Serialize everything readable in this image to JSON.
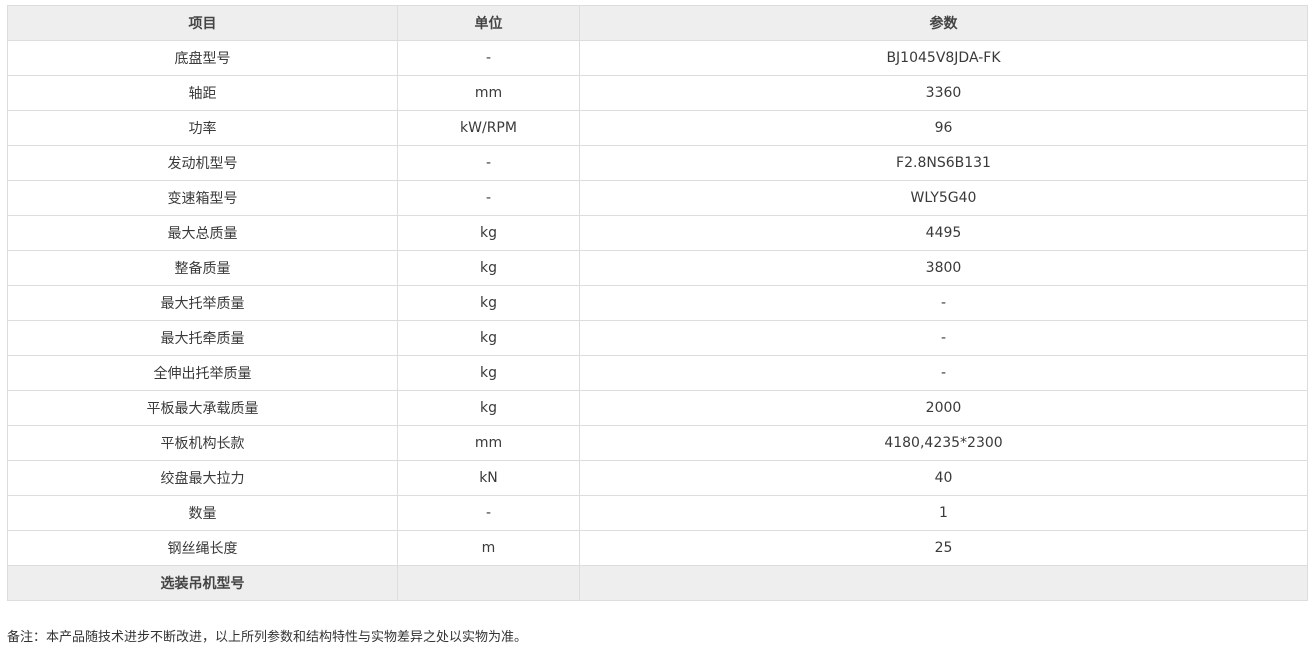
{
  "table": {
    "headers": [
      "项目",
      "单位",
      "参数"
    ],
    "rows": [
      [
        "底盘型号",
        "-",
        "BJ1045V8JDA-FK"
      ],
      [
        "轴距",
        "mm",
        "3360"
      ],
      [
        "功率",
        "kW/RPM",
        "96"
      ],
      [
        "发动机型号",
        "-",
        "F2.8NS6B131"
      ],
      [
        "变速箱型号",
        "-",
        "WLY5G40"
      ],
      [
        "最大总质量",
        "kg",
        "4495"
      ],
      [
        "整备质量",
        "kg",
        "3800"
      ],
      [
        "最大托举质量",
        "kg",
        "-"
      ],
      [
        "最大托牵质量",
        "kg",
        "-"
      ],
      [
        "全伸出托举质量",
        "kg",
        "-"
      ],
      [
        "平板最大承载质量",
        "kg",
        "2000"
      ],
      [
        "平板机构长款",
        "mm",
        "4180,4235*2300"
      ],
      [
        "绞盘最大拉力",
        "kN",
        "40"
      ],
      [
        "数量",
        "-",
        "1"
      ],
      [
        "钢丝绳长度",
        "m",
        "25"
      ]
    ],
    "section_row": {
      "label": "选装吊机型号",
      "unit": "",
      "value": ""
    }
  },
  "footnote": "备注：本产品随技术进步不断改进，以上所列参数和结构特性与实物差异之处以实物为准。"
}
